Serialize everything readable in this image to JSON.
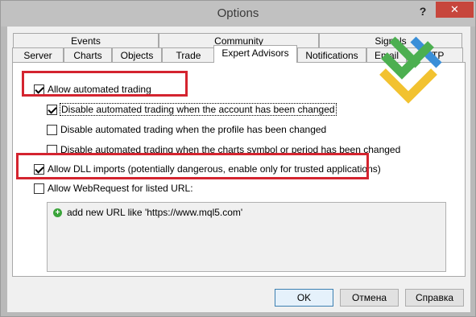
{
  "window": {
    "title": "Options",
    "help_label": "?",
    "close_label": "✕"
  },
  "tabs": {
    "row1": [
      {
        "label": "Events"
      },
      {
        "label": "Community"
      },
      {
        "label": "Signals"
      }
    ],
    "row2": [
      {
        "label": "Server"
      },
      {
        "label": "Charts"
      },
      {
        "label": "Objects"
      },
      {
        "label": "Trade"
      },
      {
        "label": "Expert Advisors",
        "active": true
      },
      {
        "label": "Notifications"
      },
      {
        "label": "Email"
      },
      {
        "label": "FTP"
      }
    ]
  },
  "options": {
    "allow_automated_trading": {
      "label": "Allow automated trading",
      "checked": true
    },
    "disable_on_account_change": {
      "label": "Disable automated trading when the account has been changed",
      "checked": true
    },
    "disable_on_profile_change": {
      "label": "Disable automated trading when the profile has been changed",
      "checked": false
    },
    "disable_on_symbol_change": {
      "label": "Disable automated trading when the charts symbol or period has been changed",
      "checked": false
    },
    "allow_dll_imports": {
      "label": "Allow DLL imports (potentially dangerous, enable only for trusted applications)",
      "checked": true
    },
    "allow_webrequest": {
      "label": "Allow WebRequest for listed URL:",
      "checked": false
    }
  },
  "url_list": {
    "add_label": "add new URL like 'https://www.mql5.com'"
  },
  "buttons": {
    "ok": "OK",
    "cancel": "Отмена",
    "help": "Справка"
  },
  "colors": {
    "highlight_box": "#d4242f",
    "close_button": "#c7463c",
    "logo_green": "#4caf50",
    "logo_blue": "#3a8fd8",
    "logo_yellow": "#f2c230"
  }
}
